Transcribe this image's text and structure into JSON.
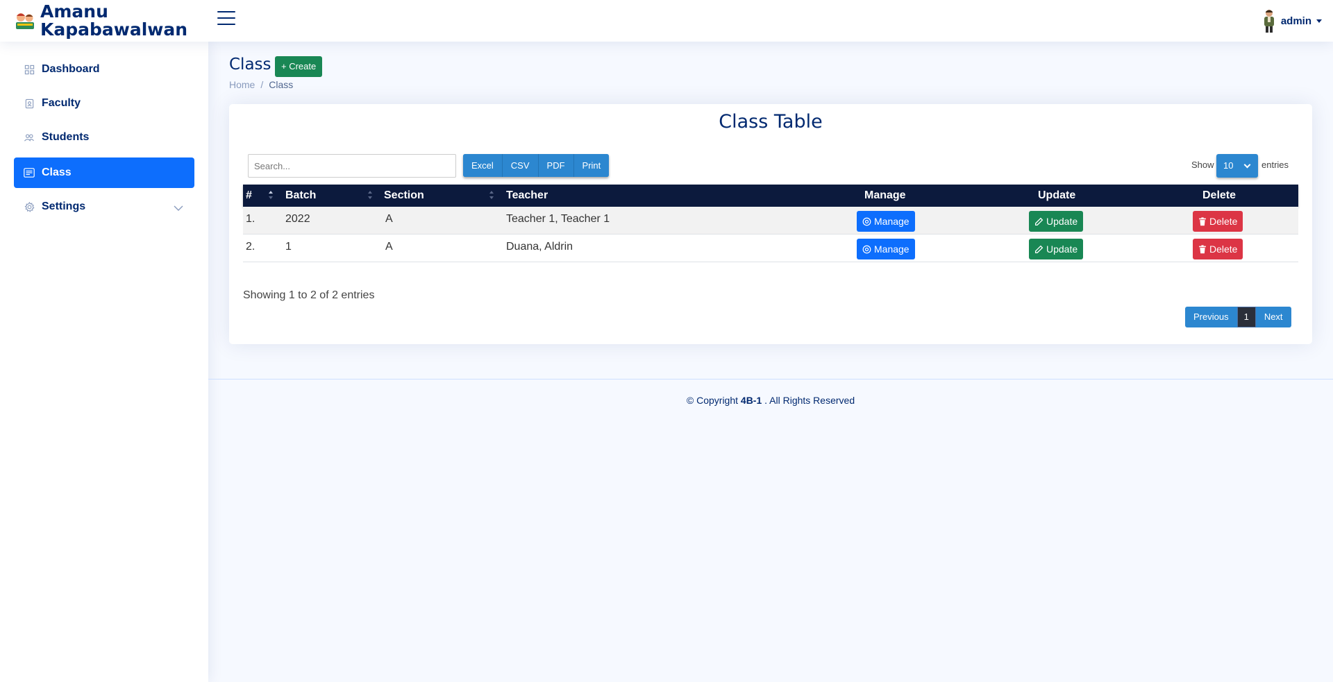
{
  "app": {
    "title_line1": "Amanu",
    "title_line2": "Kapabawalwan"
  },
  "user": {
    "name": "admin"
  },
  "sidebar": {
    "items": [
      {
        "label": "Dashboard",
        "icon": "grid-icon"
      },
      {
        "label": "Faculty",
        "icon": "person-badge-icon"
      },
      {
        "label": "Students",
        "icon": "people-icon"
      },
      {
        "label": "Class",
        "icon": "card-list-icon",
        "active": true
      },
      {
        "label": "Settings",
        "icon": "gear-icon"
      }
    ]
  },
  "page": {
    "title": "Class",
    "create_label": "+ Create",
    "breadcrumb": [
      "Home",
      "Class"
    ]
  },
  "card": {
    "title": "Class Table"
  },
  "toolbar": {
    "search_placeholder": "Search...",
    "export_buttons": [
      "Excel",
      "CSV",
      "PDF",
      "Print"
    ],
    "show_label": "Show",
    "page_size": "10",
    "entries_label": "entries"
  },
  "table": {
    "columns": [
      "#",
      "Batch",
      "Section",
      "Teacher",
      "Manage",
      "Update",
      "Delete"
    ],
    "rows": [
      {
        "num": "1.",
        "batch": "2022",
        "section": "A",
        "teacher": "Teacher 1, Teacher 1"
      },
      {
        "num": "2.",
        "batch": "1",
        "section": "A",
        "teacher": "Duana, Aldrin"
      }
    ],
    "manage_label": "Manage",
    "update_label": "Update",
    "delete_label": "Delete"
  },
  "info": "Showing 1 to 2 of 2 entries",
  "pagination": {
    "previous": "Previous",
    "current": "1",
    "next": "Next"
  },
  "footer": {
    "prefix": "© Copyright",
    "brand": "4B-1",
    "suffix": ". All Rights Reserved"
  },
  "colors": {
    "primary": "#0d6efd",
    "success": "#198754",
    "danger": "#dc3545",
    "navy": "#012970",
    "table_header": "#0c1a3d",
    "dt_button": "#2c87d0"
  }
}
